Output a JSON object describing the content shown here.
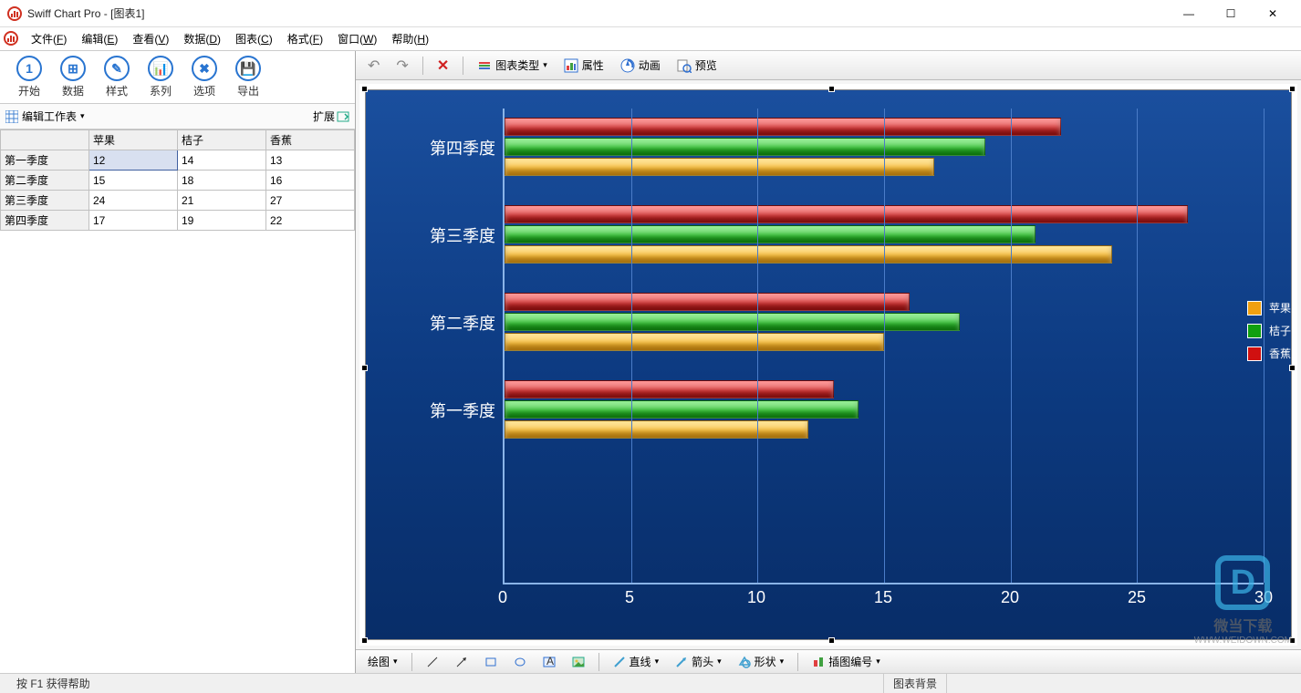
{
  "app": {
    "title": "Swiff Chart Pro - [图表1]"
  },
  "window_buttons": {
    "min": "—",
    "max": "☐",
    "close": "✕"
  },
  "menu": [
    {
      "label": "文件",
      "accel": "F"
    },
    {
      "label": "编辑",
      "accel": "E"
    },
    {
      "label": "查看",
      "accel": "V"
    },
    {
      "label": "数据",
      "accel": "D"
    },
    {
      "label": "图表",
      "accel": "C"
    },
    {
      "label": "格式",
      "accel": "F"
    },
    {
      "label": "窗口",
      "accel": "W"
    },
    {
      "label": "帮助",
      "accel": "H"
    }
  ],
  "big_toolbar": [
    {
      "id": "start",
      "label": "开始",
      "glyph": "1"
    },
    {
      "id": "data",
      "label": "数据",
      "glyph": "⊞"
    },
    {
      "id": "style",
      "label": "样式",
      "glyph": "✎"
    },
    {
      "id": "series",
      "label": "系列",
      "glyph": "📊"
    },
    {
      "id": "options",
      "label": "选项",
      "glyph": "✖"
    },
    {
      "id": "export",
      "label": "导出",
      "glyph": "💾"
    }
  ],
  "sub_toolbar": {
    "edit_sheet": "编辑工作表",
    "expand": "扩展"
  },
  "grid": {
    "columns": [
      "",
      "苹果",
      "桔子",
      "香蕉"
    ],
    "rows": [
      {
        "label": "第一季度",
        "cells": [
          "12",
          "14",
          "13"
        ],
        "selected_col": 0
      },
      {
        "label": "第二季度",
        "cells": [
          "15",
          "18",
          "16"
        ]
      },
      {
        "label": "第三季度",
        "cells": [
          "24",
          "21",
          "27"
        ]
      },
      {
        "label": "第四季度",
        "cells": [
          "17",
          "19",
          "22"
        ]
      }
    ]
  },
  "right_toolbar": {
    "undo": "↶",
    "redo": "↷",
    "delete": "✕",
    "chart_type": "图表类型",
    "properties": "属性",
    "animation": "动画",
    "preview": "预览"
  },
  "chart_data": {
    "type": "bar",
    "orientation": "horizontal",
    "categories": [
      "第一季度",
      "第二季度",
      "第三季度",
      "第四季度"
    ],
    "series": [
      {
        "name": "苹果",
        "color": "#f0a010",
        "values": [
          12,
          15,
          24,
          17
        ]
      },
      {
        "name": "桔子",
        "color": "#10a010",
        "values": [
          14,
          18,
          21,
          19
        ]
      },
      {
        "name": "香蕉",
        "color": "#d01010",
        "values": [
          13,
          16,
          27,
          22
        ]
      }
    ],
    "x_ticks": [
      0,
      5,
      10,
      15,
      20,
      25,
      30
    ],
    "xlim": [
      0,
      30
    ]
  },
  "draw_toolbar": {
    "label": "绘图",
    "line": "直线",
    "arrow": "箭头",
    "shape": "形状",
    "insert_num": "插图编号"
  },
  "status": {
    "help": "按 F1 获得帮助",
    "bg": "图表背景"
  },
  "watermark": {
    "logo": "D",
    "t1": "微当下载",
    "t2": "WWW.WEIDOWN.COM"
  }
}
